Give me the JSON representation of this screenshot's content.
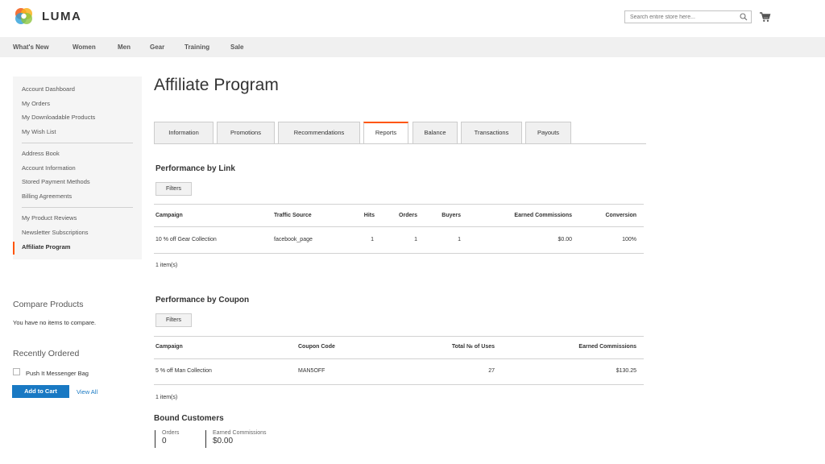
{
  "header": {
    "logo_text": "LUMA",
    "search_placeholder": "Search entire store here...",
    "accent": "#ff5501"
  },
  "nav": {
    "items": [
      "What's New",
      "Women",
      "Men",
      "Gear",
      "Training",
      "Sale"
    ]
  },
  "sidebar": {
    "group1": [
      "Account Dashboard",
      "My Orders",
      "My Downloadable Products",
      "My Wish List"
    ],
    "group2": [
      "Address Book",
      "Account Information",
      "Stored Payment Methods",
      "Billing Agreements"
    ],
    "group3": [
      "My Product Reviews",
      "Newsletter Subscriptions",
      "Affiliate Program"
    ],
    "active": "Affiliate Program"
  },
  "compare": {
    "title": "Compare Products",
    "text": "You have no items to compare."
  },
  "recent": {
    "title": "Recently Ordered",
    "item": "Push It Messenger Bag",
    "add_to_cart": "Add to Cart",
    "view_all": "View All"
  },
  "main": {
    "title": "Affiliate Program",
    "tabs": [
      "Information",
      "Promotions",
      "Recommendations",
      "Reports",
      "Balance",
      "Transactions",
      "Payouts"
    ],
    "active_tab": "Reports"
  },
  "perf_link": {
    "title": "Performance by Link",
    "filters": "Filters",
    "headers": [
      "Campaign",
      "Traffic Source",
      "Hits",
      "Orders",
      "Buyers",
      "Earned Commissions",
      "Conversion"
    ],
    "row": [
      "10 % off Gear Collection",
      "facebook_page",
      "1",
      "1",
      "1",
      "$0.00",
      "100%"
    ],
    "count": "1 item(s)"
  },
  "perf_coupon": {
    "title": "Performance by Coupon",
    "filters": "Filters",
    "headers": [
      "Campaign",
      "Coupon Code",
      "Total № of Uses",
      "Earned Commissions"
    ],
    "row": [
      "5 % off Man Collection",
      "MAN5OFF",
      "27",
      "$130.25"
    ],
    "count": "1 item(s)"
  },
  "bound": {
    "title": "Bound Customers",
    "orders_label": "Orders",
    "orders_value": "0",
    "commissions_label": "Earned Commissions",
    "commissions_value": "$0.00"
  }
}
